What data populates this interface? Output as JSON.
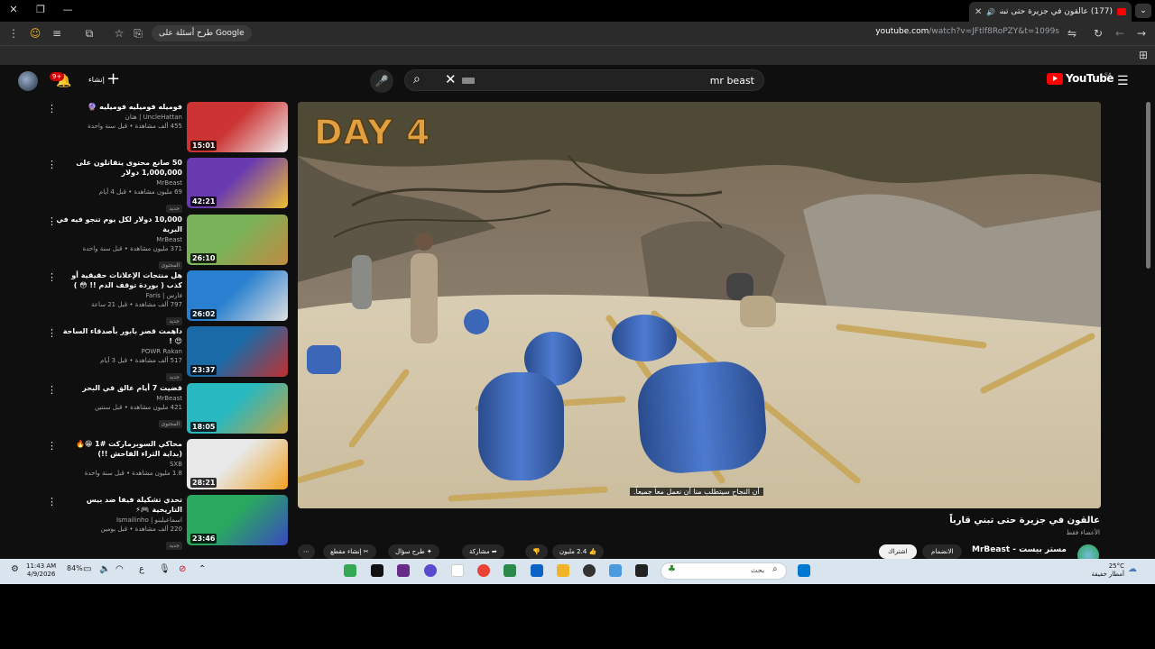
{
  "browser": {
    "tab_title": "(177) عالقون في جزيرة حتى تبني قارباً",
    "url_host": "youtube.com",
    "url_path": "/watch?v=JFtlf8RoPZY&t=1099s",
    "google_ask": "طرح أسئلة على Google"
  },
  "youtube": {
    "search_query": "mr beast",
    "logo_text": "YouTube",
    "country": "SA",
    "create_label": "إنشاء",
    "notif_count": "9+"
  },
  "video": {
    "overlay_text": "DAY 4",
    "caption": "أن النجاح سيتطلب منا أن نعمل معاً جميعاً.",
    "title": "عالقون في جزيرة حتى تبني قارباً",
    "members_only": "الأعضاء فقط",
    "channel": "MrBeast - مستر بيست",
    "subscribers": "",
    "join_label": "الانضمام",
    "subscribe_label": "اشتراك",
    "likes": "2.4 مليون",
    "share_label": "مشاركة",
    "ask_label": "طرح سؤال",
    "clip_label": "إنشاء مقطع"
  },
  "recommendations": [
    {
      "title": "فوميله فوميليه فوميليه 🔮",
      "channel": "UncleHattan | هتان",
      "views": "455 ألف مشاهدة • قبل سنة واحدة",
      "badge": "",
      "duration": "15:01"
    },
    {
      "title": "50 صانع محتوى يتقاتلون على 1,000,000 دولار",
      "channel": "MrBeast",
      "views": "69 مليون مشاهدة • قبل 4 أيام",
      "badge": "جديد",
      "duration": "42:21"
    },
    {
      "title": "10,000 دولار لكل يوم تنجو فيه في البرية",
      "channel": "MrBeast",
      "views": "371 مليون مشاهدة • قبل سنة واحدة",
      "badge": "المحتوى",
      "duration": "26:10"
    },
    {
      "title": "هل منتجات الإعلانات حقيقية أو كذب ( بوردة توقف الدم !! 😳 )",
      "channel": "فارس | Faris",
      "views": "797 ألف مشاهدة • قبل 21 ساعة",
      "badge": "جديد",
      "duration": "26:02"
    },
    {
      "title": "داهمت قصر بابور بأصدقاء الساحة 😍 !",
      "channel": "POWR Rakan",
      "views": "517 ألف مشاهدة • قبل 3 أيام",
      "badge": "جديد",
      "duration": "23:37"
    },
    {
      "title": "قضيت 7 أيام عالق في البحر",
      "channel": "MrBeast",
      "views": "421 مليون مشاهدة • قبل سنتين",
      "badge": "المحتوى",
      "duration": "18:05"
    },
    {
      "title": "محاكي السوبرماركت #1 😁🔥 (بداية الثراء الفاحش !!)",
      "channel": "SXB",
      "views": "1.8 مليون مشاهدة • قبل سنة واحدة",
      "badge": "",
      "duration": "28:21"
    },
    {
      "title": "تحدي تشكيلة فيفا ضد بيس التاريخية 🎮⚡",
      "channel": "اسماعيلينو | Ismailinho",
      "views": "220 ألف مشاهدة • قبل يومين",
      "badge": "جديد",
      "duration": "23:46"
    }
  ],
  "taskbar": {
    "time": "11:43 AM",
    "date": "4/9/2026",
    "battery": "84%",
    "search_placeholder": "بحث",
    "lang": "ع",
    "temp": "25°C",
    "weather": "أمطار خفيفة"
  }
}
